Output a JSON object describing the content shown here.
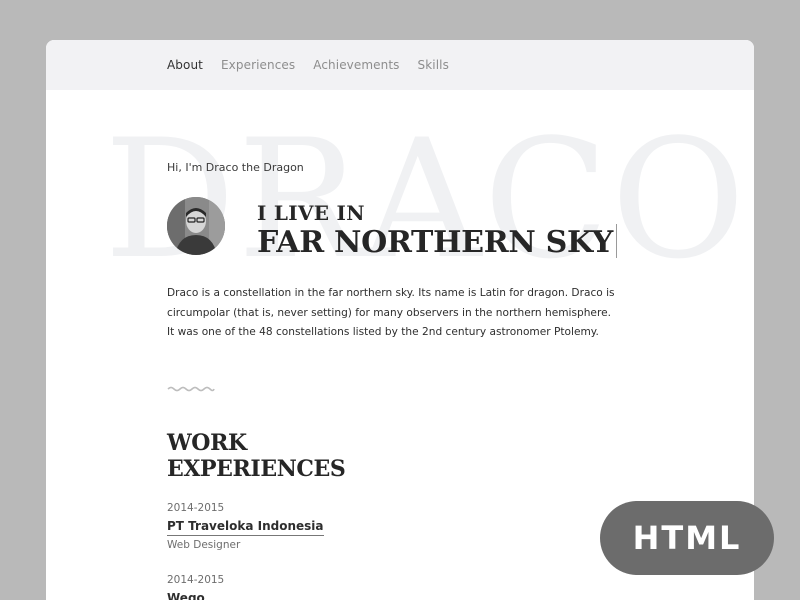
{
  "nav": {
    "items": [
      "About",
      "Experiences",
      "Achievements",
      "Skills"
    ],
    "active_index": 0
  },
  "background_word": "DRACO",
  "hero": {
    "greeting": "Hi, I'm Draco the Dragon",
    "line1": "I LIVE IN",
    "line2": "FAR NORTHERN SKY",
    "avatar_icon": "person-avatar-icon",
    "description": "Draco is a constellation in the far northern sky. Its name is Latin for dragon. Draco is circumpolar (that is, never setting) for many observers in the northern hemisphere. It was one of the 48 constellations listed by the 2nd century astronomer Ptolemy."
  },
  "divider_icon": "squiggle-icon",
  "work": {
    "title_line1": "WORK",
    "title_line2": "EXPERIENCES",
    "items": [
      {
        "years": "2014-2015",
        "company": "PT Traveloka Indonesia",
        "role": "Web Designer"
      },
      {
        "years": "2014-2015",
        "company": "Wego",
        "role": ""
      }
    ]
  },
  "badge": {
    "label": "HTML"
  },
  "colors": {
    "page_bg": "#b9b9b9",
    "nav_bg": "#f2f2f4",
    "text_dark": "#262626",
    "text_muted": "#8d8d8d",
    "badge_bg": "#6c6c6c"
  }
}
